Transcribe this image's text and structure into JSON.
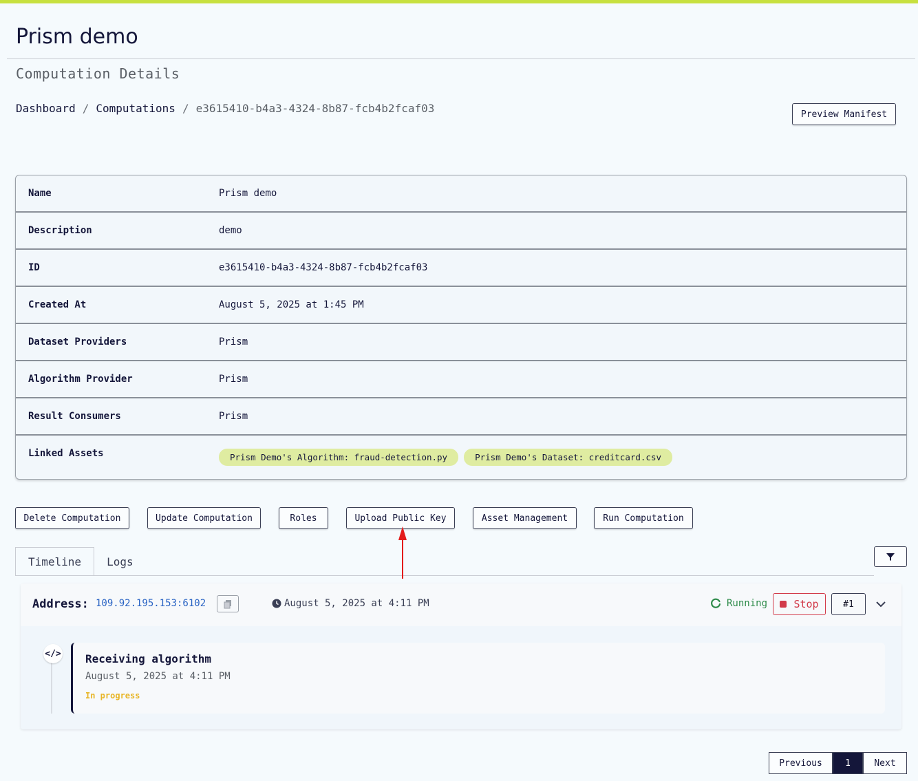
{
  "header": {
    "app_title": "Prism demo",
    "subtitle": "Computation Details"
  },
  "breadcrumb": {
    "items": [
      "Dashboard",
      "Computations",
      "e3615410-b4a3-4324-8b87-fcb4b2fcaf03"
    ],
    "separator": "/"
  },
  "toolbar": {
    "preview_manifest": "Preview Manifest"
  },
  "details": {
    "rows": [
      {
        "key": "Name",
        "value": "Prism demo"
      },
      {
        "key": "Description",
        "value": "demo"
      },
      {
        "key": "ID",
        "value": "e3615410-b4a3-4324-8b87-fcb4b2fcaf03"
      },
      {
        "key": "Created At",
        "value": "August 5, 2025 at 1:45 PM"
      },
      {
        "key": "Dataset Providers",
        "value": "Prism"
      },
      {
        "key": "Algorithm Provider",
        "value": "Prism"
      },
      {
        "key": "Result Consumers",
        "value": "Prism"
      }
    ],
    "linked_assets": {
      "key": "Linked Assets",
      "chips": [
        "Prism Demo's Algorithm: fraud-detection.py",
        "Prism Demo's Dataset: creditcard.csv"
      ]
    }
  },
  "actions": {
    "delete": "Delete Computation",
    "update": "Update Computation",
    "roles": "Roles",
    "upload_key": "Upload Public Key",
    "asset_mgmt": "Asset Management",
    "run": "Run Computation"
  },
  "tabs": {
    "timeline": "Timeline",
    "logs": "Logs"
  },
  "panel": {
    "address_label": "Address:",
    "address_value": "109.92.195.153:6102",
    "timestamp": "August 5, 2025 at 4:11 PM",
    "status": "Running",
    "stop_label": "Stop",
    "run_number": "#1",
    "step": {
      "icon_glyph": "</>",
      "title": "Receiving algorithm",
      "time": "August 5, 2025 at 4:11 PM",
      "status": "In progress"
    }
  },
  "pagination": {
    "previous": "Previous",
    "current": "1",
    "next": "Next"
  },
  "colors": {
    "accent_bar": "#c7e03f",
    "chip": "#dfeca1",
    "running": "#2e8b4a",
    "stop": "#d23b4a",
    "in_progress": "#e8b526",
    "annotation_arrow": "#e31b1b"
  }
}
